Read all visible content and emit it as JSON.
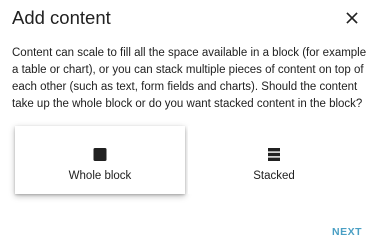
{
  "dialog": {
    "title": "Add content",
    "close_icon": "close-icon",
    "description": "Content can scale to fill all the space available in a block (for example a table or chart), or you can stack multiple pieces of content on top of each other (such as text, form fields and charts). Should the content take up the whole block or do you want stacked content in the block?",
    "options": [
      {
        "label": "Whole block",
        "icon": "whole-block-icon",
        "selected": true
      },
      {
        "label": "Stacked",
        "icon": "stacked-icon",
        "selected": false
      }
    ],
    "next_label": "NEXT"
  },
  "colors": {
    "text": "#212121",
    "accent": "#4a9fc4",
    "background": "#ffffff"
  }
}
